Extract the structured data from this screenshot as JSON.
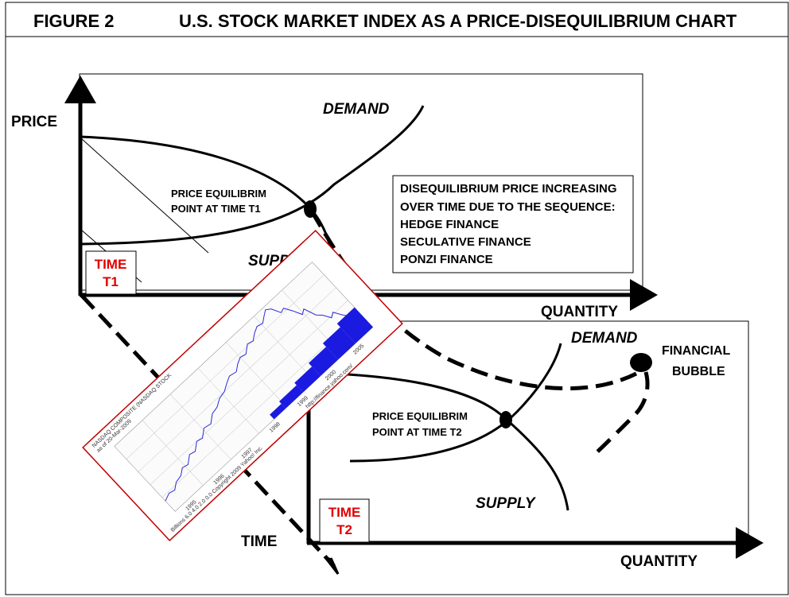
{
  "header": {
    "figure": "FIGURE 2",
    "title": "U.S. STOCK MARKET INDEX AS A PRICE-DISEQUILIBRIUM CHART"
  },
  "axes": {
    "price": "PRICE",
    "quantity_top": "QUANTITY",
    "quantity_bottom": "QUANTITY",
    "time": "TIME"
  },
  "curves": {
    "demand_top": "DEMAND",
    "supply_top": "SUPPLY",
    "demand_bottom": "DEMAND",
    "supply_bottom": "SUPPLY"
  },
  "equilibrium_t1": [
    "PRICE EQUILIBRIM",
    "POINT AT TIME T1"
  ],
  "equilibrium_t2": [
    "PRICE EQUILIBRIM",
    "POINT AT TIME T2"
  ],
  "time_t1": [
    "TIME",
    "T1"
  ],
  "time_t2": [
    "TIME",
    "T2"
  ],
  "disequilibrium_box": [
    "DISEQUILIBRIUM PRICE INCREASING",
    "OVER TIME DUE TO THE SEQUENCE:",
    "HEDGE FINANCE",
    "SECULATIVE FINANCE",
    "PONZI FINANCE"
  ],
  "bubble": [
    "FINANCIAL",
    "BUBBLE"
  ],
  "inset_chart": {
    "header_lines": [
      "NASDAQ COMPOSITE (NASDAQ STOCK",
      "as of 20-Mar-2009",
      "3500",
      "3000",
      "2500",
      "2000",
      "1500"
    ],
    "x_ticks": [
      "1995",
      "1996",
      "1997",
      "1998",
      "1999",
      "2000",
      "2005"
    ],
    "side_text": "Billions 6.0 4.0 2.0 0.0  Copyright 2009 Yahoo! Inc.",
    "url": "http://finance.yahoo.com/"
  },
  "colors": {
    "time_label": "#e00000",
    "inset_border": "#c00000",
    "index_line": "#2a2adb",
    "volume": "#1a1ae0"
  }
}
